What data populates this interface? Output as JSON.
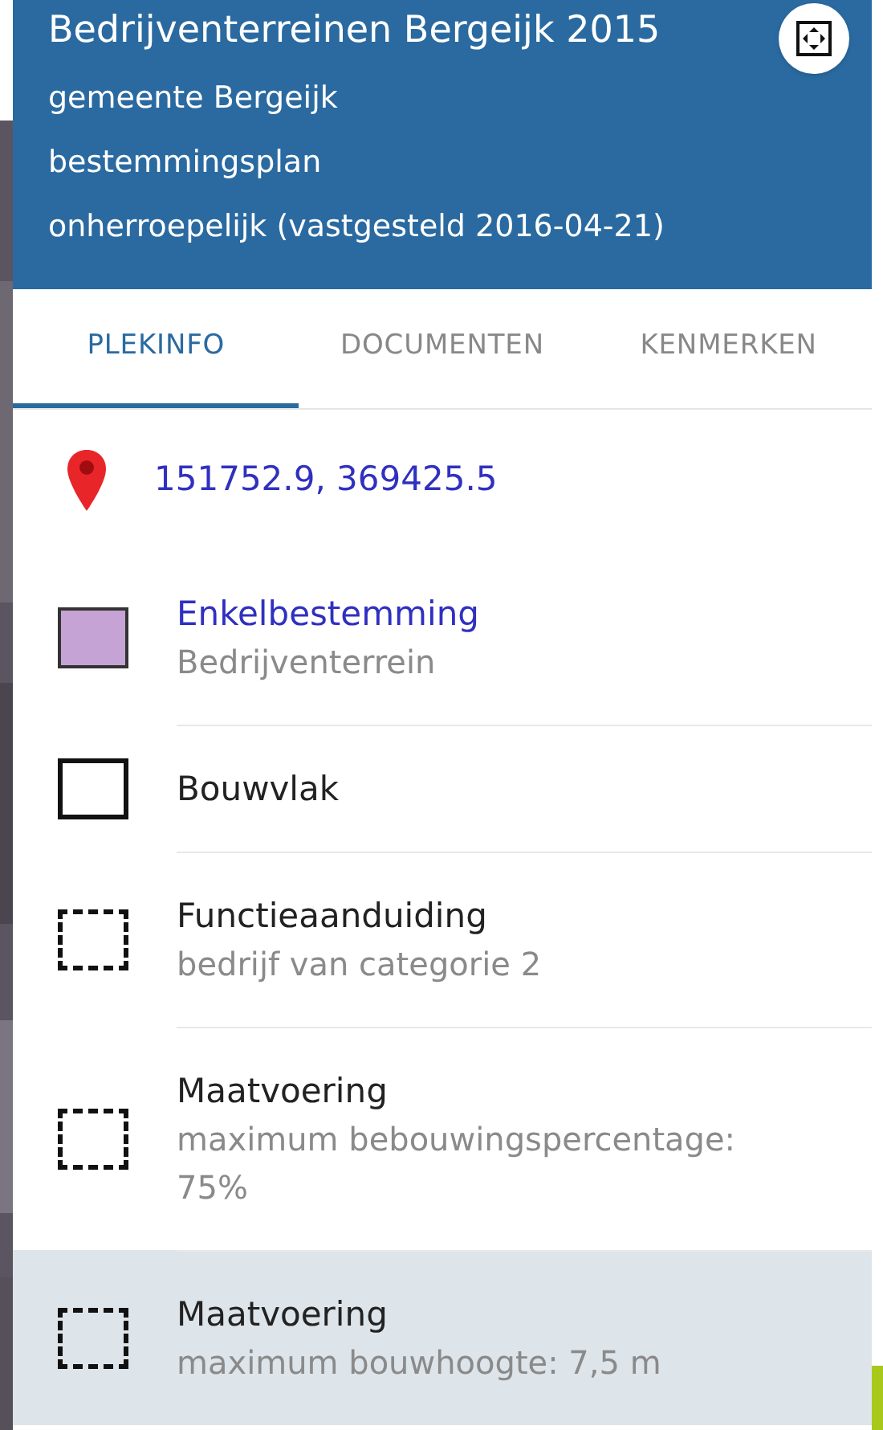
{
  "header": {
    "title": "Bedrijventerreinen Bergeijk 2015",
    "lines": [
      "gemeente Bergeijk",
      "bestemmingsplan",
      "onherroepelijk (vastgesteld 2016-04-21)"
    ]
  },
  "tabs": [
    {
      "label": "PLEKINFO",
      "selected": true
    },
    {
      "label": "DOCUMENTEN",
      "selected": false
    },
    {
      "label": "KENMERKEN",
      "selected": false
    }
  ],
  "location": {
    "coordinates": "151752.9, 369425.5"
  },
  "rows": [
    {
      "kind": "filled",
      "color": "#c5a3d5",
      "title": "Enkelbestemming",
      "link": true,
      "subtitle": "Bedrijventerrein",
      "selected": false
    },
    {
      "kind": "solid",
      "title": "Bouwvlak",
      "link": false,
      "selected": false
    },
    {
      "kind": "dashed",
      "title": "Functieaanduiding",
      "link": false,
      "subtitle": "bedrijf van categorie 2",
      "selected": false
    },
    {
      "kind": "dashed",
      "title": "Maatvoering",
      "link": false,
      "subtitle": "maximum bebouwingspercentage: 75%",
      "selected": false
    },
    {
      "kind": "dashed",
      "title": "Maatvoering",
      "link": false,
      "subtitle": "maximum bouwhoogte: 7,5 m",
      "selected": true
    }
  ]
}
